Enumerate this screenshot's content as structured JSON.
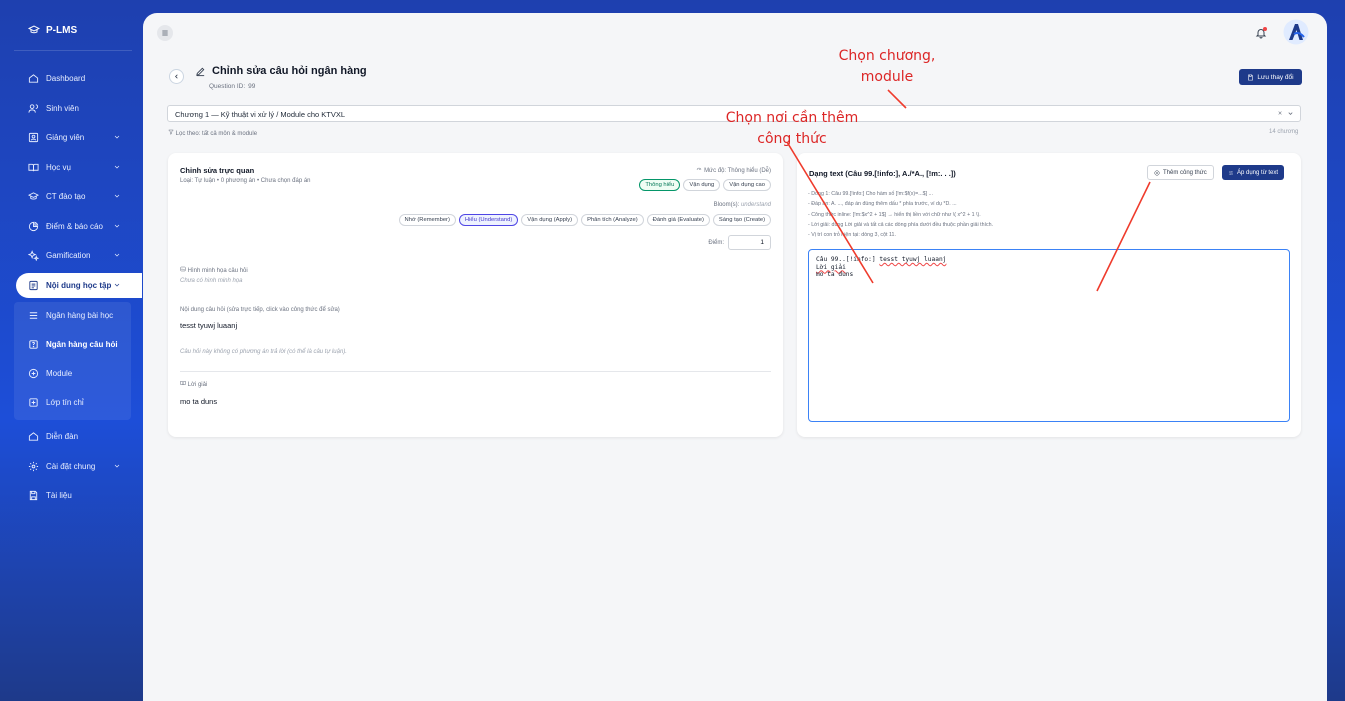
{
  "brand": {
    "name": "P-LMS"
  },
  "sidebar": {
    "items": [
      {
        "label": "Dashboard",
        "icon": "home-icon"
      },
      {
        "label": "Sinh viên",
        "icon": "users-icon"
      },
      {
        "label": "Giảng viên",
        "icon": "id-card-icon",
        "chevron": true
      },
      {
        "label": "Học vụ",
        "icon": "book-open-icon",
        "chevron": true
      },
      {
        "label": "CT đào tạo",
        "icon": "graduation-cap-icon",
        "chevron": true
      },
      {
        "label": "Điểm & báo cáo",
        "icon": "pie-chart-icon",
        "chevron": true
      },
      {
        "label": "Gamification",
        "icon": "sparkles-icon",
        "chevron": true
      },
      {
        "label": "Nội dung học tập",
        "icon": "file-text-icon",
        "chevron": true,
        "active": true
      }
    ],
    "sub_items": [
      {
        "label": "Ngân hàng bài học",
        "icon": "list-icon"
      },
      {
        "label": "Ngân hàng câu hỏi",
        "icon": "question-bank-icon",
        "selected": true
      },
      {
        "label": "Module",
        "icon": "plus-circle-icon"
      },
      {
        "label": "Lớp tín chỉ",
        "icon": "square-plus-icon"
      }
    ],
    "bottom_items": [
      {
        "label": "Diễn đàn",
        "icon": "home-icon"
      },
      {
        "label": "Cài đặt chung",
        "icon": "settings-icon",
        "chevron": true
      },
      {
        "label": "Tài liệu",
        "icon": "save-icon"
      }
    ]
  },
  "header": {
    "title": "Chỉnh sửa câu hỏi ngân hàng",
    "question_id_label": "Question ID:",
    "question_id": "99",
    "save_label": "Lưu thay đổi"
  },
  "filter": {
    "selected": "Chương 1 — Kỹ thuật vi xử lý / Module cho KTVXL",
    "clear": "×",
    "hint": "Lọc theo: tất cả môn & module",
    "count": "14 chương"
  },
  "visual_editor": {
    "title": "Chỉnh sửa trực quan",
    "meta": "Loại: Tự luận • 0 phương án • Chưa chọn đáp án",
    "difficulty_label": "Mức độ: Thông hiểu (Dễ)",
    "difficulty_options": [
      "Thông hiểu",
      "Vận dụng",
      "Vận dụng cao"
    ],
    "difficulty_selected": 0,
    "bloom_label": "Bloom(s):",
    "bloom_value": "understand",
    "bloom_options": [
      "Nhớ (Remember)",
      "Hiểu (Understand)",
      "Vận dụng (Apply)",
      "Phân tích (Analyze)",
      "Đánh giá (Evaluate)",
      "Sáng tạo (Create)"
    ],
    "bloom_selected": 1,
    "score_label": "Điểm:",
    "score_value": "1",
    "image_label": "Hình minh họa câu hỏi",
    "image_hint": "Chưa có hình minh họa",
    "content_label": "Nội dung câu hỏi (sửa trực tiếp, click vào công thức để sửa)",
    "content_value": "tesst tyuwj luaanj",
    "no_options_hint": "Câu hỏi này không có phương án trả lời (có thể là câu tự luận).",
    "solution_label": "Lời giải",
    "solution_value": "mo ta duns"
  },
  "text_editor": {
    "title": "Dạng text (Câu 99.[!info:], A./*A., [!m:. . .])",
    "add_formula_label": "Thêm công thức",
    "apply_label": "Áp dụng từ text",
    "notes": [
      "- Dòng 1: Câu 99.[!info:] Cho hàm số [!m:$f(x)=...$] ...",
      "- Đáp án: A. ..., đáp án đúng thêm dấu * phía trước, ví dụ *D. ...",
      "- Công thức inline: [!m:$x^2 + 1$] → hiển thị liền với chữ như \\( x^2 + 1 \\).",
      "- Lời giải: dùng Lời giải và tất cả các dòng phía dưới đều thuộc phần giải thích.",
      "- Vị trí con trỏ hiện tại: dòng 3, cột 11."
    ],
    "content_line1_prefix": "Câu 99..[!info:] ",
    "content_line1_typo": "tesst tyuwj luaanj",
    "content_line2": "Lời giải",
    "content_line3": "mo ta duns"
  },
  "annotations": {
    "chapter_note_line1": "Chọn chương,",
    "chapter_note_line2": "module",
    "formula_note_line1": "Chọn nơi cần thêm",
    "formula_note_line2": "công thức",
    "color": "#dc2626"
  },
  "colors": {
    "primary": "#1e3a8a",
    "sidebar": "#1d4ed8",
    "accent_green": "#059669",
    "accent_indigo": "#4f46e5"
  }
}
